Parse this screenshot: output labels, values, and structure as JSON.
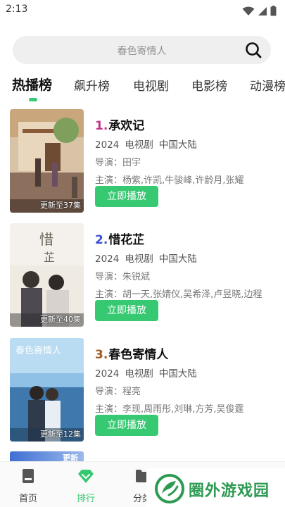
{
  "status_bar": {
    "time": "2:13"
  },
  "search": {
    "placeholder": "春色寄情人"
  },
  "tabs": [
    {
      "label": "热播榜",
      "active": true
    },
    {
      "label": "飙升榜",
      "active": false
    },
    {
      "label": "电视剧",
      "active": false
    },
    {
      "label": "电影榜",
      "active": false
    },
    {
      "label": "动漫榜",
      "active": false
    }
  ],
  "items": [
    {
      "rank": "1.",
      "rank_color": "#c2338b",
      "title": "承欢记",
      "year": "2024",
      "type": "电视剧",
      "region": "中国大陆",
      "director": "导演：田宇",
      "cast": "主演：杨紫,许凯,牛骏峰,许龄月,张耀",
      "badge": "更新至37集",
      "button": "立即播放"
    },
    {
      "rank": "2.",
      "rank_color": "#3b4fd6",
      "title": "惜花芷",
      "year": "2024",
      "type": "电视剧",
      "region": "中国大陆",
      "director": "导演：朱锐斌",
      "cast": "主演：胡一天,张婧仪,吴希泽,卢昱晓,边程",
      "badge": "更新至40集",
      "button": "立即播放"
    },
    {
      "rank": "3.",
      "rank_color": "#a05a20",
      "title": "春色寄情人",
      "year": "2024",
      "type": "电视剧",
      "region": "中国大陆",
      "director": "导演：程亮",
      "cast": "主演：李现,周雨彤,刘琳,方芳,吴俊霆",
      "badge": "更新至12集",
      "button": "立即播放"
    }
  ],
  "partial_item": {
    "badge": "更新"
  },
  "bottom_nav": [
    {
      "label": "首页",
      "icon": "home-icon",
      "active": false
    },
    {
      "label": "排行",
      "icon": "diamond-icon",
      "active": true
    },
    {
      "label": "分类",
      "icon": "folder-icon",
      "active": false
    }
  ],
  "watermark": {
    "text": "圈外游戏园"
  },
  "colors": {
    "accent": "#36c971",
    "watermark": "#2d9a52"
  }
}
